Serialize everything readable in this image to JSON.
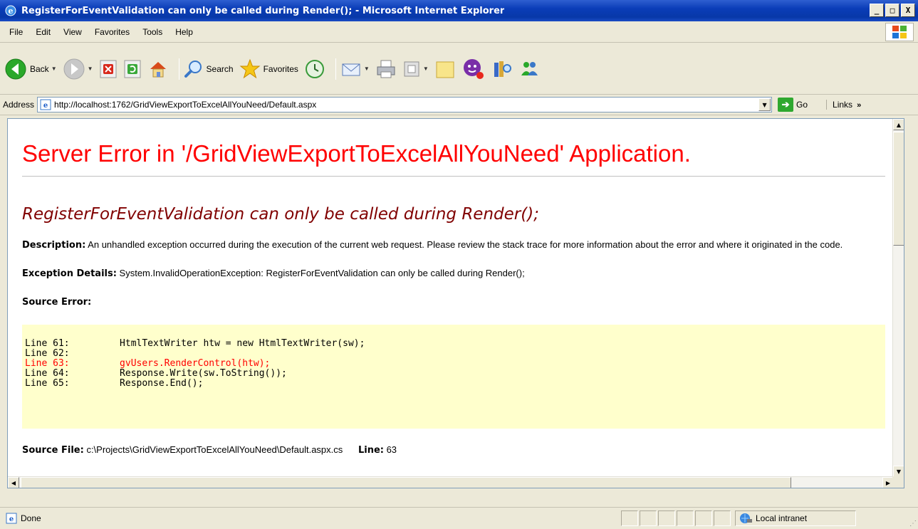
{
  "window": {
    "title": "RegisterForEventValidation can only be called during Render(); - Microsoft Internet Explorer",
    "controls": {
      "minimize": "_",
      "maximize": "□",
      "close": "X"
    }
  },
  "menu": [
    "File",
    "Edit",
    "View",
    "Favorites",
    "Tools",
    "Help"
  ],
  "toolbar": {
    "back_label": "Back",
    "search_label": "Search",
    "favorites_label": "Favorites"
  },
  "address": {
    "label": "Address",
    "url": "http://localhost:1762/GridViewExportToExcelAllYouNeed/Default.aspx",
    "go_label": "Go",
    "links_label": "Links"
  },
  "page": {
    "title": "Server Error in '/GridViewExportToExcelAllYouNeed' Application.",
    "error_heading": "RegisterForEventValidation can only be called during Render();",
    "description_label": "Description:",
    "description_text": " An unhandled exception occurred during the execution of the current web request. Please review the stack trace for more information about the error and where it originated in the code.",
    "exception_label": "Exception Details:",
    "exception_text": " System.InvalidOperationException: RegisterForEventValidation can only be called during Render();",
    "source_error_label": "Source Error:",
    "code_lines": [
      {
        "text": "Line 61:         HtmlTextWriter htw = new HtmlTextWriter(sw);",
        "highlight": false
      },
      {
        "text": "Line 62:",
        "highlight": false
      },
      {
        "text": "Line 63:         gvUsers.RenderControl(htw);",
        "highlight": true
      },
      {
        "text": "Line 64:         Response.Write(sw.ToString());",
        "highlight": false
      },
      {
        "text": "Line 65:         Response.End();",
        "highlight": false
      }
    ],
    "source_file_label": "Source File:",
    "source_file_path": " c:\\Projects\\GridViewExportToExcelAllYouNeed\\Default.aspx.cs",
    "line_label": "Line:",
    "line_number": " 63"
  },
  "status": {
    "text": "Done",
    "zone": "Local intranet"
  }
}
